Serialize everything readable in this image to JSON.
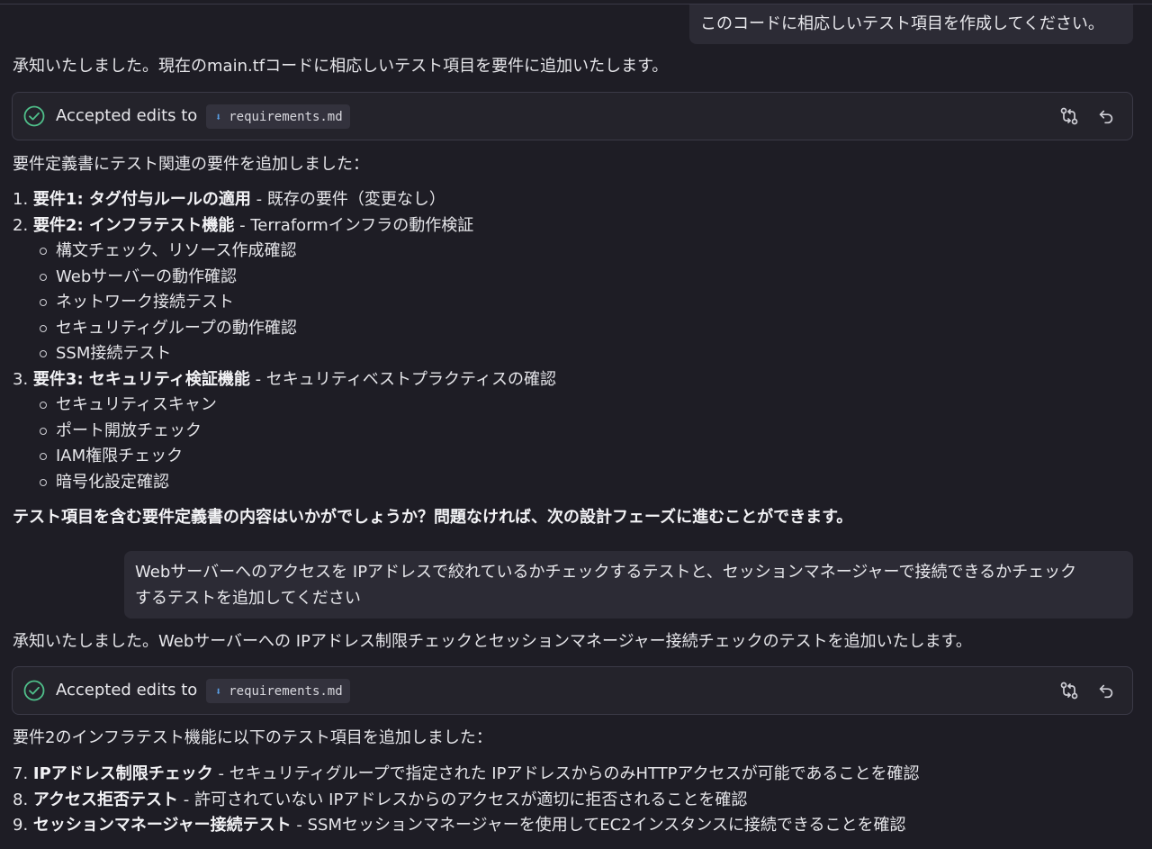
{
  "messages": {
    "user1": "このコードに相応しいテスト項目を作成してください。",
    "reply1_intro": "承知いたしました。現在のmain.tfコードに相応しいテスト項目を要件に追加いたします。",
    "edit1": {
      "label": "Accepted edits to",
      "file": "requirements.md"
    },
    "reply1_summary": "要件定義書にテスト関連の要件を追加しました：",
    "list1": [
      {
        "num": "1.",
        "title": "要件1: タグ付与ルールの適用",
        "desc": " - 既存の要件（変更なし）",
        "subs": []
      },
      {
        "num": "2.",
        "title": "要件2: インフラテスト機能",
        "desc": " - Terraformインフラの動作検証",
        "subs": [
          "構文チェック、リソース作成確認",
          "Webサーバーの動作確認",
          "ネットワーク接続テスト",
          "セキュリティグループの動作確認",
          "SSM接続テスト"
        ]
      },
      {
        "num": "3.",
        "title": "要件3: セキュリティ検証機能",
        "desc": " - セキュリティベストプラクティスの確認",
        "subs": [
          "セキュリティスキャン",
          "ポート開放チェック",
          "IAM権限チェック",
          "暗号化設定確認"
        ]
      }
    ],
    "reply1_question": "テスト項目を含む要件定義書の内容はいかがでしょうか？問題なければ、次の設計フェーズに進むことができます。",
    "user2_line1": "Webサーバーへのアクセスを IPアドレスで絞れているかチェックするテストと、セッションマネージャーで接続できるかチェック",
    "user2_line2": "するテストを追加してください",
    "reply2_intro": "承知いたしました。Webサーバーへの IPアドレス制限チェックとセッションマネージャー接続チェックのテストを追加いたします。",
    "edit2": {
      "label": "Accepted edits to",
      "file": "requirements.md"
    },
    "reply2_summary": "要件2のインフラテスト機能に以下のテスト項目を追加しました：",
    "list2": [
      {
        "num": "7.",
        "title": "IPアドレス制限チェック",
        "desc": " - セキュリティグループで指定された IPアドレスからのみHTTPアクセスが可能であることを確認"
      },
      {
        "num": "8.",
        "title": "アクセス拒否テスト",
        "desc": " - 許可されていない IPアドレスからのアクセスが適切に拒否されることを確認"
      },
      {
        "num": "9.",
        "title": "セッションマネージャー接続テスト",
        "desc": " - SSMセッションマネージャーを使用してEC2インスタンスに接続できることを確認"
      }
    ]
  },
  "colors": {
    "background": "#1e1d25",
    "bubble": "#2c2b35",
    "check": "#4fbf8a",
    "chip_arrow": "#5aa0e6"
  },
  "icons": {
    "accepted": "check-circle-icon",
    "diff": "diff-compare-icon",
    "undo": "undo-icon",
    "file": "download-arrow-icon"
  }
}
